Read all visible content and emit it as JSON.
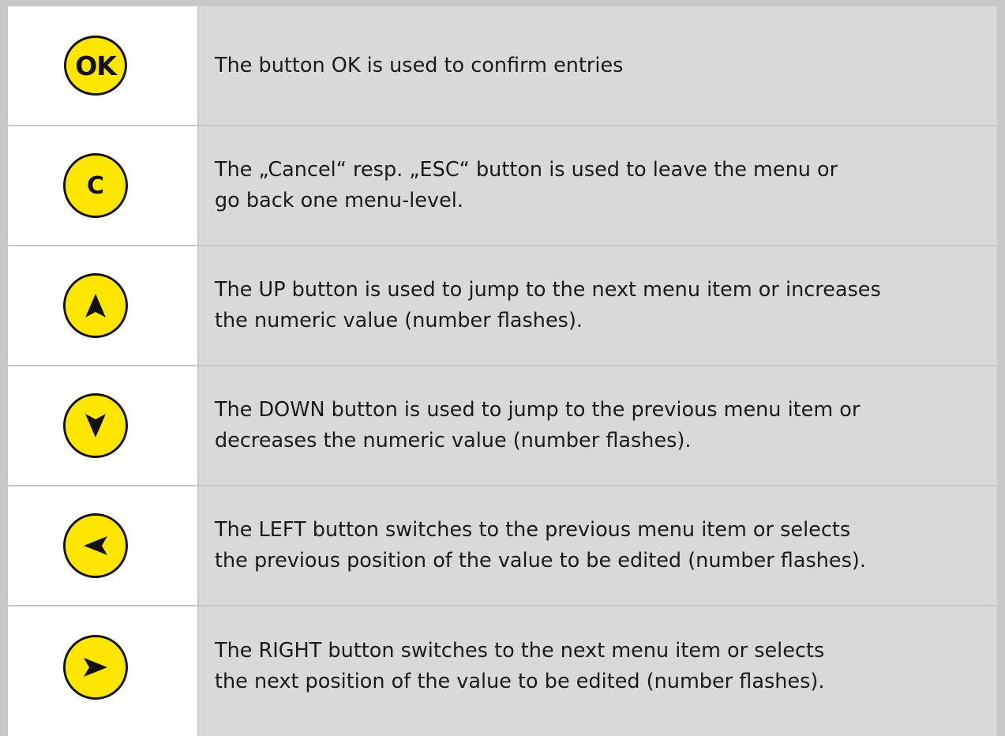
{
  "colors": {
    "button_fill": "#ffe600",
    "button_outline": "#141414",
    "text_cell_bg": "#d9d9d9",
    "icon_cell_bg": "#ffffff",
    "border": "#c8c8c8"
  },
  "rows": [
    {
      "icon": "ok-button-icon",
      "button_label": "OK",
      "description": "The button OK is used to confirm entries"
    },
    {
      "icon": "cancel-button-icon",
      "button_label": "C",
      "description": "The „Cancel“ resp. „ESC“ button is used to leave the menu or\ngo back one menu-level."
    },
    {
      "icon": "up-arrow-icon",
      "description": "The UP button is used to jump to the next menu item or increases\nthe numeric value (number flashes)."
    },
    {
      "icon": "down-arrow-icon",
      "description": "The DOWN button is used to jump to the previous menu item or\ndecreases the numeric value (number flashes)."
    },
    {
      "icon": "left-arrow-icon",
      "description": "The LEFT button switches to the previous menu item or selects\nthe previous position of the value to be edited (number flashes)."
    },
    {
      "icon": "right-arrow-icon",
      "description": "The RIGHT button switches to the next menu item or selects\nthe next position of the value to be edited (number flashes)."
    }
  ]
}
